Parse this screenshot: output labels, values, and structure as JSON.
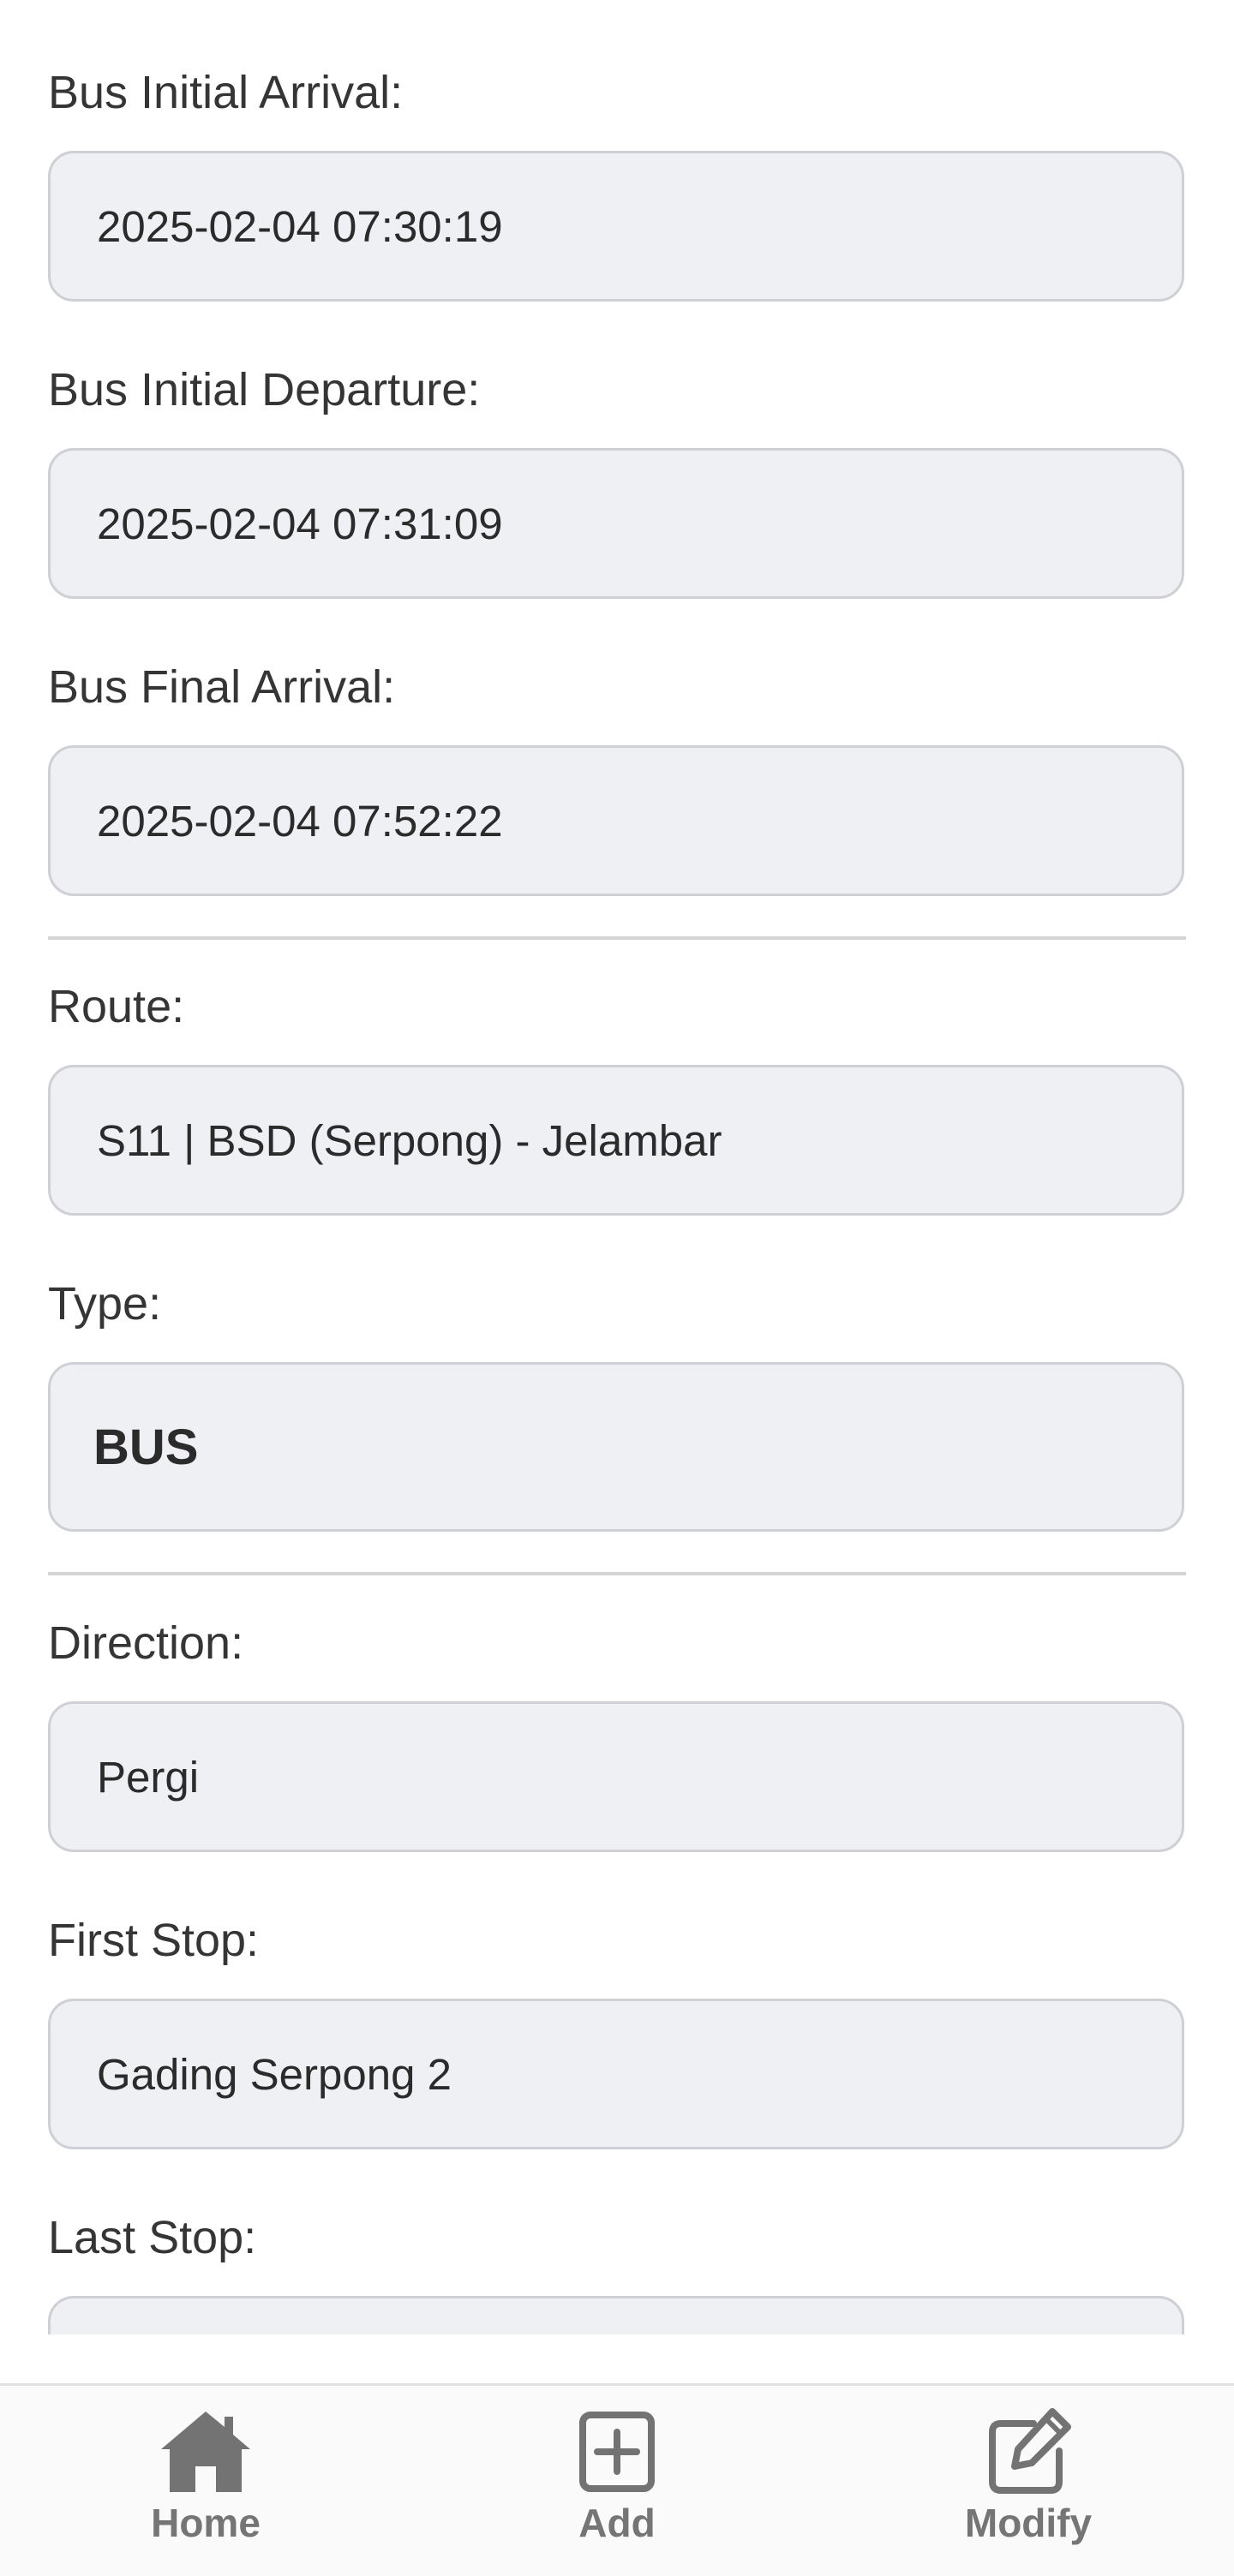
{
  "form": {
    "bus_initial_arrival": {
      "label": "Bus Initial Arrival:",
      "value": "2025-02-04 07:30:19"
    },
    "bus_initial_departure": {
      "label": "Bus Initial Departure:",
      "value": "2025-02-04 07:31:09"
    },
    "bus_final_arrival": {
      "label": "Bus Final Arrival:",
      "value": "2025-02-04 07:52:22"
    },
    "route": {
      "label": "Route:",
      "value": "S11 | BSD (Serpong) - Jelambar"
    },
    "type": {
      "label": "Type:",
      "value": "BUS"
    },
    "direction": {
      "label": "Direction:",
      "value": "Pergi"
    },
    "first_stop": {
      "label": "First Stop:",
      "value": "Gading Serpong 2"
    },
    "last_stop": {
      "label": "Last Stop:",
      "value": ""
    }
  },
  "nav": {
    "items": [
      {
        "label": "Home",
        "icon": "home-icon"
      },
      {
        "label": "Add",
        "icon": "add-square-icon"
      },
      {
        "label": "Modify",
        "icon": "edit-icon"
      }
    ]
  },
  "colors": {
    "field_bg": "#eff0f4",
    "field_border": "#cfd0d6",
    "nav_icon": "#737373"
  }
}
